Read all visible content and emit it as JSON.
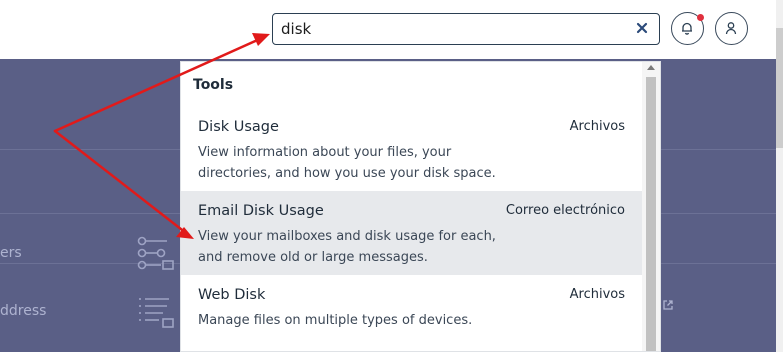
{
  "search": {
    "value": "disk",
    "clear_icon": "close-icon"
  },
  "header_icons": {
    "notifications": "bell-icon",
    "account": "user-icon"
  },
  "background": {
    "row1_label": "ers",
    "row2_label": "ddress"
  },
  "dropdown": {
    "section_title": "Tools",
    "results": [
      {
        "title": "Disk Usage",
        "category": "Archivos",
        "description": "View information about your files, your directories, and how you use your disk space."
      },
      {
        "title": "Email Disk Usage",
        "category": "Correo electrónico",
        "description": "View your mailboxes and disk usage for each, and remove old or large messages."
      },
      {
        "title": "Web Disk",
        "category": "Archivos",
        "description": "Manage files on multiple types of devices."
      }
    ]
  },
  "colors": {
    "accent": "#5a5f86",
    "arrow": "#e11a1a",
    "notification_dot": "#e0303e"
  }
}
